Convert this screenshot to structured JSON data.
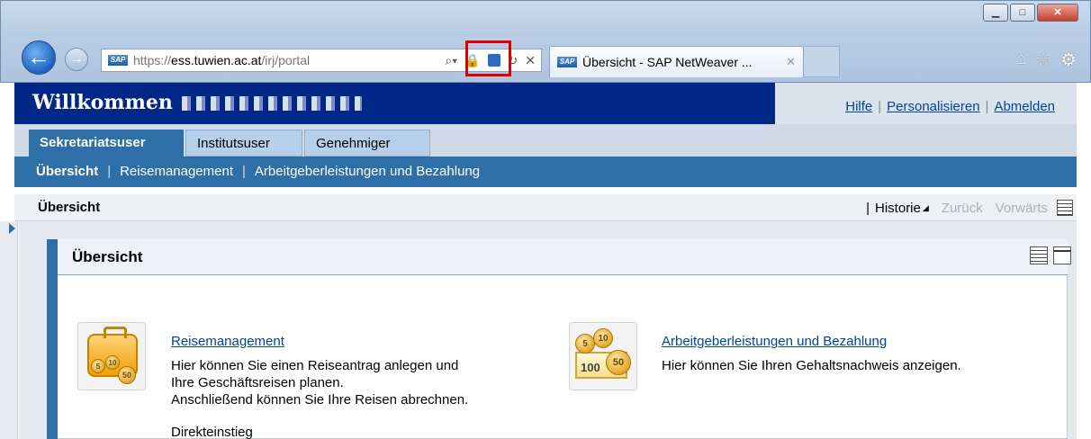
{
  "browser": {
    "url_prefix": "https://",
    "url_domain": "ess.tuwien.ac.at",
    "url_path": "/irj/portal",
    "tab_title": "Übersicht - SAP NetWeaver ...",
    "favicon_text": "SAP"
  },
  "header": {
    "welcome": "Willkommen",
    "links": {
      "help": "Hilfe",
      "personalize": "Personalisieren",
      "logout": "Abmelden"
    }
  },
  "tabs": [
    {
      "label": "Sekretariatsuser",
      "active": true
    },
    {
      "label": "Institutsuser",
      "active": false
    },
    {
      "label": "Genehmiger",
      "active": false
    }
  ],
  "subnav": [
    {
      "label": "Übersicht",
      "active": true
    },
    {
      "label": "Reisemanagement",
      "active": false
    },
    {
      "label": "Arbeitgeberleistungen und Bezahlung",
      "active": false
    }
  ],
  "pagebar": {
    "title": "Übersicht",
    "history": "Historie",
    "back": "Zurück",
    "forward": "Vorwärts"
  },
  "panel": {
    "title": "Übersicht",
    "items": [
      {
        "link": "Reisemanagement",
        "lines": [
          "Hier können Sie einen Reiseantrag anlegen und",
          "Ihre Geschäftsreisen planen.",
          "Anschließend können Sie Ihre Reisen abrechnen."
        ],
        "extra": "Direkteinstieg"
      },
      {
        "link": "Arbeitgeberleistungen und Bezahlung",
        "lines": [
          "Hier können Sie Ihren Gehaltsnachweis anzeigen."
        ]
      }
    ]
  },
  "icons": {
    "coins": [
      "5",
      "10",
      "50"
    ],
    "note": "100"
  }
}
